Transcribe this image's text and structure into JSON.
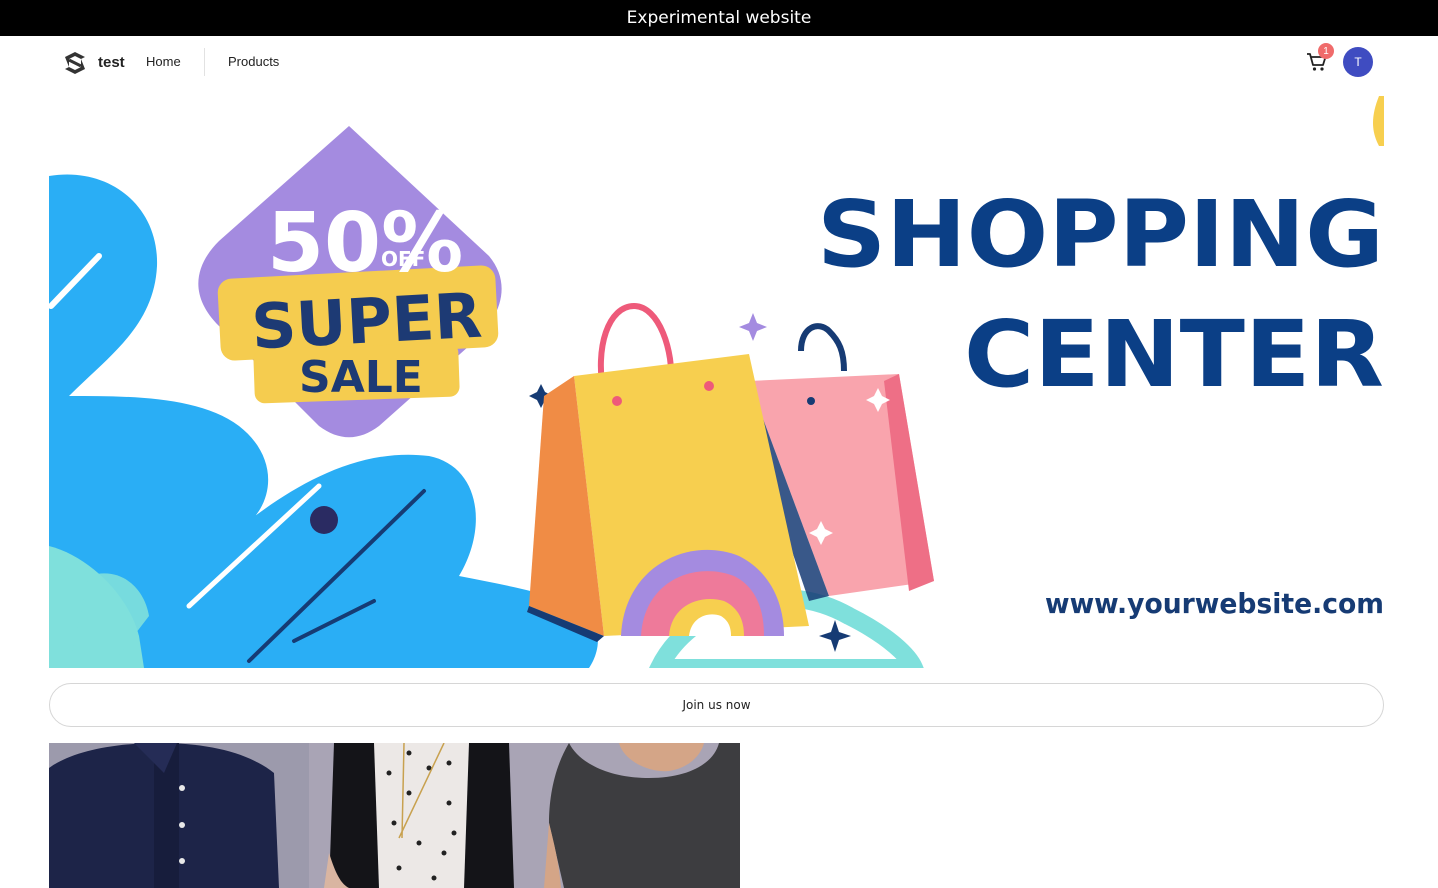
{
  "announcement": {
    "text": "Experimental website"
  },
  "header": {
    "brand": "test",
    "nav": [
      {
        "label": "Home"
      },
      {
        "label": "Products"
      }
    ],
    "cart": {
      "count": "1",
      "icon": "cart-icon"
    },
    "user": {
      "initial": "T"
    }
  },
  "hero": {
    "discount": "50%",
    "discount_suffix": "OFF",
    "badge_line1": "SUPER",
    "badge_line2": "SALE",
    "headline_line1": "SHOPPING",
    "headline_line2": "CENTER",
    "website": "www.yourwebsite.com"
  },
  "cta": {
    "label": "Join us now"
  },
  "colors": {
    "topbar": "#000000",
    "avatar": "#3f4cc1",
    "badge": "#f06b6b",
    "headline": "#0b3f86",
    "hero_blue": "#2aaef5",
    "hero_purple": "#a48be0"
  }
}
